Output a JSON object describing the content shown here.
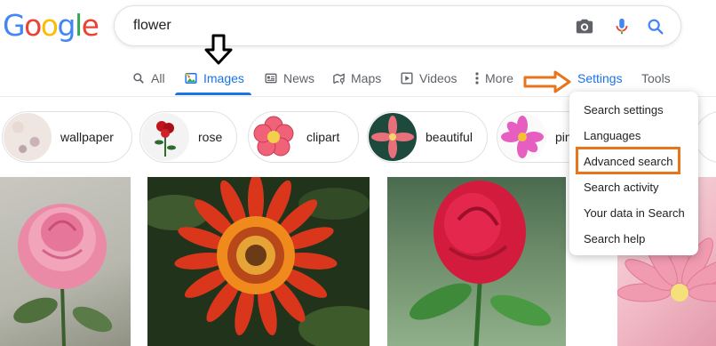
{
  "logo": {
    "letters": [
      "G",
      "o",
      "o",
      "g",
      "l",
      "e"
    ],
    "colors": [
      "#4285f4",
      "#ea4335",
      "#fbbc05",
      "#4285f4",
      "#34a853",
      "#ea4335"
    ]
  },
  "search": {
    "query": "flower",
    "icons": [
      "camera-icon",
      "mic-icon",
      "search-icon"
    ]
  },
  "tabs": [
    {
      "label": "All",
      "icon": "search-icon"
    },
    {
      "label": "Images",
      "icon": "image-icon",
      "active": true
    },
    {
      "label": "News",
      "icon": "news-icon"
    },
    {
      "label": "Maps",
      "icon": "map-icon"
    },
    {
      "label": "Videos",
      "icon": "video-icon"
    },
    {
      "label": "More",
      "icon": "more-vert-icon"
    },
    {
      "label": "Settings"
    },
    {
      "label": "Tools"
    }
  ],
  "chips": [
    {
      "label": "wallpaper"
    },
    {
      "label": "rose"
    },
    {
      "label": "clipart"
    },
    {
      "label": "beautiful"
    },
    {
      "label": "pin"
    }
  ],
  "settings_menu": {
    "items": [
      "Search settings",
      "Languages",
      "Advanced search",
      "Search activity",
      "Your data in Search",
      "Search help"
    ],
    "highlighted": "Advanced search"
  },
  "annotations": {
    "arrow_color": "#e8741b",
    "accent": "#1a73e8"
  }
}
